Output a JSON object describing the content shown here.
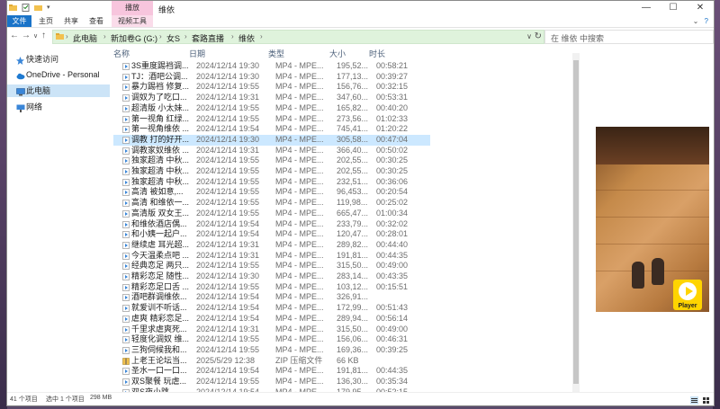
{
  "window": {
    "title": "维依",
    "context_tab": "播放",
    "controls": [
      "—",
      "☐",
      "✕"
    ]
  },
  "ribbon": {
    "tabs": [
      "文件",
      "主页",
      "共享",
      "查看",
      "视频工具"
    ]
  },
  "address": {
    "segments": [
      "此电脑",
      "新加卷G (G:)",
      "女S",
      "套路直播",
      "维依"
    ]
  },
  "search": {
    "placeholder": "在 维依 中搜索"
  },
  "nav": [
    {
      "label": "快速访问",
      "icon": "star-icon"
    },
    {
      "label": "OneDrive - Personal",
      "icon": "cloud-icon"
    },
    {
      "label": "此电脑",
      "icon": "computer-icon",
      "selected": true
    },
    {
      "label": "网络",
      "icon": "network-icon"
    }
  ],
  "columns": {
    "name": "名称",
    "date": "日期",
    "type": "类型",
    "size": "大小",
    "duration": "时长"
  },
  "files": [
    {
      "name": "3S重度踢裆调...",
      "date": "2024/12/14 19:30",
      "type": "MP4 - MPE...",
      "size": "195,52...",
      "duration": "00:58:21"
    },
    {
      "name": "TJ：酒吧公调...",
      "date": "2024/12/14 19:30",
      "type": "MP4 - MPE...",
      "size": "177,13...",
      "duration": "00:39:27"
    },
    {
      "name": "暴力踢裆 修复...",
      "date": "2024/12/14 19:55",
      "type": "MP4 - MPE...",
      "size": "156,76...",
      "duration": "00:32:15"
    },
    {
      "name": "调奴为了吃口...",
      "date": "2024/12/14 19:31",
      "type": "MP4 - MPE...",
      "size": "347,60...",
      "duration": "00:53:31"
    },
    {
      "name": "超清版 小太妹...",
      "date": "2024/12/14 19:55",
      "type": "MP4 - MPE...",
      "size": "165,82...",
      "duration": "00:40:20"
    },
    {
      "name": "第一视角 红绿...",
      "date": "2024/12/14 19:55",
      "type": "MP4 - MPE...",
      "size": "273,56...",
      "duration": "01:02:33"
    },
    {
      "name": "第一视角维依 ...",
      "date": "2024/12/14 19:54",
      "type": "MP4 - MPE...",
      "size": "745,41...",
      "duration": "01:20:22"
    },
    {
      "name": "调教 打的好开...",
      "date": "2024/12/14 19:30",
      "type": "MP4 - MPE...",
      "size": "305,58...",
      "duration": "00:47:04",
      "selected": true
    },
    {
      "name": "调教家奴维依 ...",
      "date": "2024/12/14 19:31",
      "type": "MP4 - MPE...",
      "size": "366,40...",
      "duration": "00:50:02"
    },
    {
      "name": "独家超清 中秋...",
      "date": "2024/12/14 19:55",
      "type": "MP4 - MPE...",
      "size": "202,55...",
      "duration": "00:30:25"
    },
    {
      "name": "独家超清 中秋...",
      "date": "2024/12/14 19:55",
      "type": "MP4 - MPE...",
      "size": "202,55...",
      "duration": "00:30:25"
    },
    {
      "name": "独家超清 中秋...",
      "date": "2024/12/14 19:55",
      "type": "MP4 - MPE...",
      "size": "232,51...",
      "duration": "00:36:06"
    },
    {
      "name": "高清 被如意,...",
      "date": "2024/12/14 19:55",
      "type": "MP4 - MPE...",
      "size": "96,453...",
      "duration": "00:20:54"
    },
    {
      "name": "高清 和维依一...",
      "date": "2024/12/14 19:55",
      "type": "MP4 - MPE...",
      "size": "119,98...",
      "duration": "00:25:02"
    },
    {
      "name": "高清版 双女王...",
      "date": "2024/12/14 19:55",
      "type": "MP4 - MPE...",
      "size": "665,47...",
      "duration": "01:00:34"
    },
    {
      "name": "和维依酒店偶...",
      "date": "2024/12/14 19:54",
      "type": "MP4 - MPE...",
      "size": "233,79...",
      "duration": "00:32:02"
    },
    {
      "name": "和小姨一起户...",
      "date": "2024/12/14 19:54",
      "type": "MP4 - MPE...",
      "size": "120,47...",
      "duration": "00:28:01"
    },
    {
      "name": "继续虐 耳光超...",
      "date": "2024/12/14 19:31",
      "type": "MP4 - MPE...",
      "size": "289,82...",
      "duration": "00:44:40"
    },
    {
      "name": "今天温柔点吧 ...",
      "date": "2024/12/14 19:31",
      "type": "MP4 - MPE...",
      "size": "191,81...",
      "duration": "00:44:35"
    },
    {
      "name": "经典恋足 两只...",
      "date": "2024/12/14 19:55",
      "type": "MP4 - MPE...",
      "size": "315,50...",
      "duration": "00:49:00"
    },
    {
      "name": "精彩恋足 随性...",
      "date": "2024/12/14 19:30",
      "type": "MP4 - MPE...",
      "size": "283,14...",
      "duration": "00:43:35"
    },
    {
      "name": "精彩恋足口舌 ...",
      "date": "2024/12/14 19:55",
      "type": "MP4 - MPE...",
      "size": "103,12...",
      "duration": "00:15:51"
    },
    {
      "name": "酒吧群调维依...",
      "date": "2024/12/14 19:54",
      "type": "MP4 - MPE...",
      "size": "326,91...",
      "duration": ""
    },
    {
      "name": "就爱训不听话...",
      "date": "2024/12/14 19:54",
      "type": "MP4 - MPE...",
      "size": "172,99...",
      "duration": "00:51:43"
    },
    {
      "name": "虐爽 精彩恋足...",
      "date": "2024/12/14 19:54",
      "type": "MP4 - MPE...",
      "size": "289,94...",
      "duration": "00:56:14"
    },
    {
      "name": "千里求虐爽死...",
      "date": "2024/12/14 19:31",
      "type": "MP4 - MPE...",
      "size": "315,50...",
      "duration": "00:49:00"
    },
    {
      "name": "轻度化调奴 维...",
      "date": "2024/12/14 19:55",
      "type": "MP4 - MPE...",
      "size": "156,06...",
      "duration": "00:46:31"
    },
    {
      "name": "三狗伺候我和...",
      "date": "2024/12/14 19:55",
      "type": "MP4 - MPE...",
      "size": "169,36...",
      "duration": "00:39:25"
    },
    {
      "name": "上老王论坛当...",
      "date": "2025/5/29 12:38",
      "type": "ZIP 压缩文件",
      "size": "66 KB",
      "duration": "",
      "zip": true
    },
    {
      "name": "圣水一口一口...",
      "date": "2024/12/14 19:54",
      "type": "MP4 - MPE...",
      "size": "191,81...",
      "duration": "00:44:35"
    },
    {
      "name": "双S聚餐 玩虐...",
      "date": "2024/12/14 19:55",
      "type": "MP4 - MPE...",
      "size": "136,30...",
      "duration": "00:35:34"
    },
    {
      "name": "双S夜小跳...",
      "date": "2024/12/14 19:54",
      "type": "MP4 - MPE...",
      "size": "179,95...",
      "duration": "00:52:15"
    }
  ],
  "preview": {
    "badge": "Player",
    "colors": {
      "badge": "#ffd400"
    }
  },
  "status": {
    "count": "41 个项目",
    "selection": "选中 1 个项目",
    "size": "298 MB"
  },
  "colors": {
    "accent": "#1a73c8",
    "selected_row": "#cce8ff",
    "address_bg": "#dff3dc",
    "context_tab": "#f7c5dd"
  }
}
